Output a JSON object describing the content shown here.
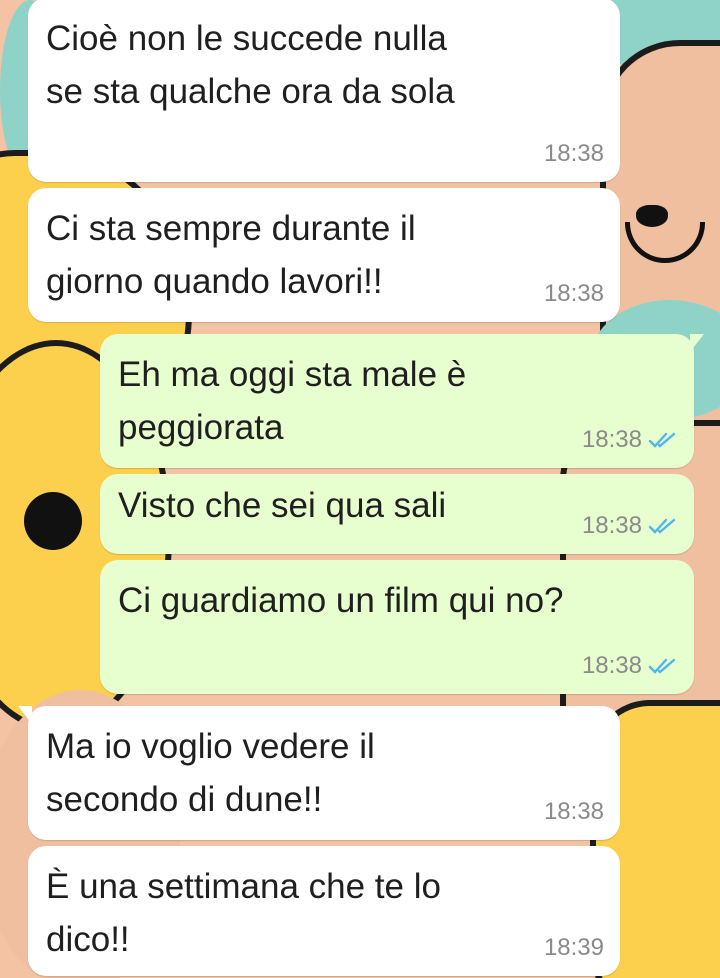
{
  "colors": {
    "incoming_bubble": "#ffffff",
    "outgoing_bubble": "#e7fecf",
    "read_ticks": "#4fb6ec",
    "timestamp": "#8a8a8a"
  },
  "messages": [
    {
      "direction": "incoming",
      "text": "Cioè non le succede nulla\nse sta qualche ora da sola",
      "time": "18:38"
    },
    {
      "direction": "incoming",
      "text": "Ci sta sempre durante il\ngiorno quando lavori!!",
      "time": "18:38"
    },
    {
      "direction": "outgoing",
      "text": "Eh ma oggi sta male è\npeggiorata",
      "time": "18:38",
      "status": "read"
    },
    {
      "direction": "outgoing",
      "text": "Visto che sei qua sali",
      "time": "18:38",
      "status": "read"
    },
    {
      "direction": "outgoing",
      "text": "Ci guardiamo un film qui no?",
      "time": "18:38",
      "status": "read"
    },
    {
      "direction": "incoming",
      "text": "Ma io voglio vedere il\nsecondo di dune!!",
      "time": "18:38"
    },
    {
      "direction": "incoming",
      "text": "È una settimana che te lo\ndico!!",
      "time": "18:39"
    }
  ]
}
